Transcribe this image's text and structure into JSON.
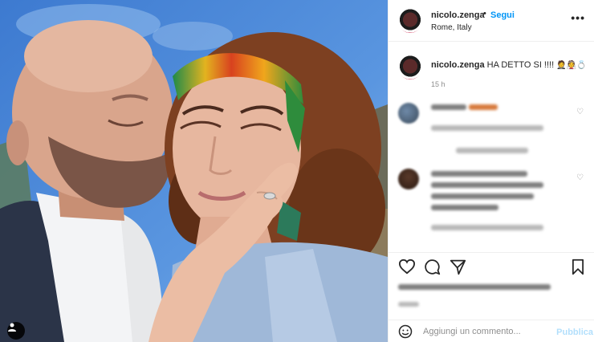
{
  "post": {
    "username": "nicolo.zenga",
    "follow_label": "Segui",
    "follow_separator": "•",
    "location": "Rome, Italy",
    "more_label": "•••"
  },
  "caption": {
    "username": "nicolo.zenga",
    "text": "HA DETTO SI !!!! ",
    "emoji": "🤵👰💍",
    "time": "15 h"
  },
  "comments": [
    {
      "state": "blurred"
    },
    {
      "state": "blurred"
    }
  ],
  "actions": {
    "like": "heart-icon",
    "comment": "comment-icon",
    "share": "paper-plane-icon",
    "save": "bookmark-icon"
  },
  "add_comment": {
    "placeholder": "Aggiungi un commento...",
    "publish_label": "Pubblica"
  },
  "colors": {
    "link_blue": "#0095f6",
    "publish_disabled": "#b2dffc",
    "meta_gray": "#8e8e8e",
    "border": "#efefef"
  }
}
